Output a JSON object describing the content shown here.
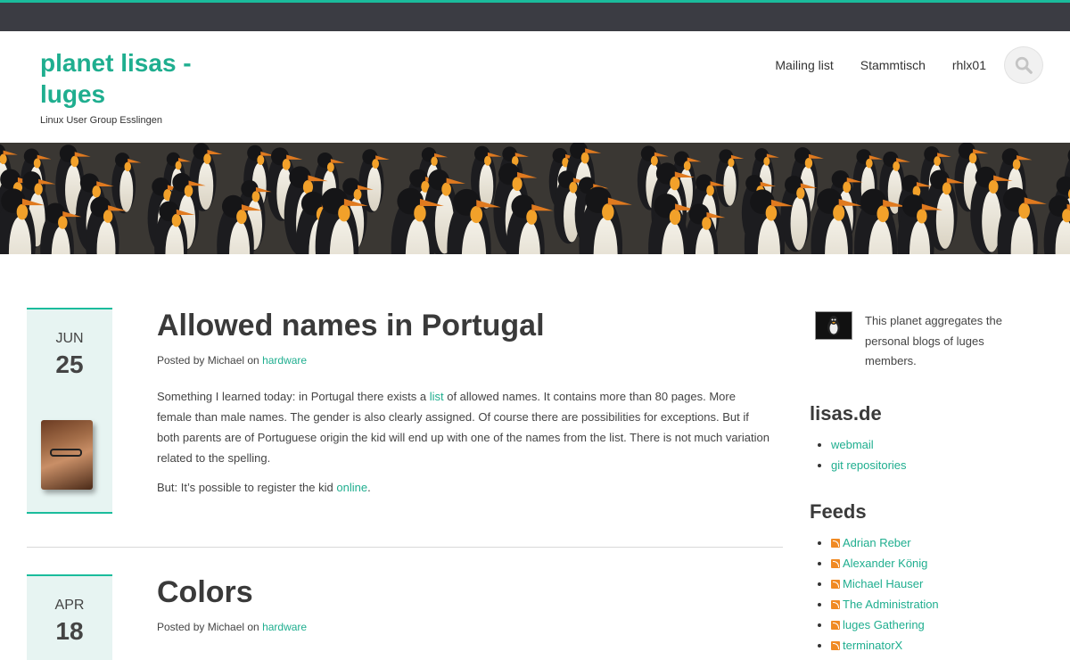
{
  "site": {
    "title": "planet lisas - luges",
    "description": "Linux User Group Esslingen"
  },
  "nav": {
    "items": [
      "Mailing list",
      "Stammtisch",
      "rhlx01"
    ],
    "search_icon": "search-icon"
  },
  "colors": {
    "accent": "#1abc9c",
    "link": "#1fae8f",
    "topbar": "#3b3c43",
    "date_box": "#e7f4f2"
  },
  "posts": [
    {
      "month": "JUN",
      "day": "25",
      "title": "Allowed names in Portugal",
      "meta_prefix": "Posted by Michael on",
      "category": "hardware",
      "paragraph1": {
        "before": "Something I learned today: in Portugal there exists a",
        "link": "list",
        "after": "of allowed names. It contains more than 80 pages. More female than male names. The gender is also clearly assigned. Of course there are possibilities for exceptions. But if both parents are of Portuguese origin the kid will end up with one of the names from the list. There is not much variation related to the spelling."
      },
      "paragraph2": {
        "before": "But: It’s possible to register the kid",
        "link": "online",
        "after": "."
      }
    },
    {
      "month": "APR",
      "day": "18",
      "title": "Colors",
      "meta_prefix": "Posted by Michael on",
      "category": "hardware"
    }
  ],
  "sidebar": {
    "planet_text": "This planet aggregates the personal blogs of luges members.",
    "lisas_title": "lisas.de",
    "lisas_links": [
      "webmail",
      "git repositories"
    ],
    "feeds_title": "Feeds",
    "feeds": [
      "Adrian Reber",
      "Alexander König",
      "Michael Hauser",
      "The Administration",
      "luges Gathering",
      "terminatorX"
    ]
  }
}
